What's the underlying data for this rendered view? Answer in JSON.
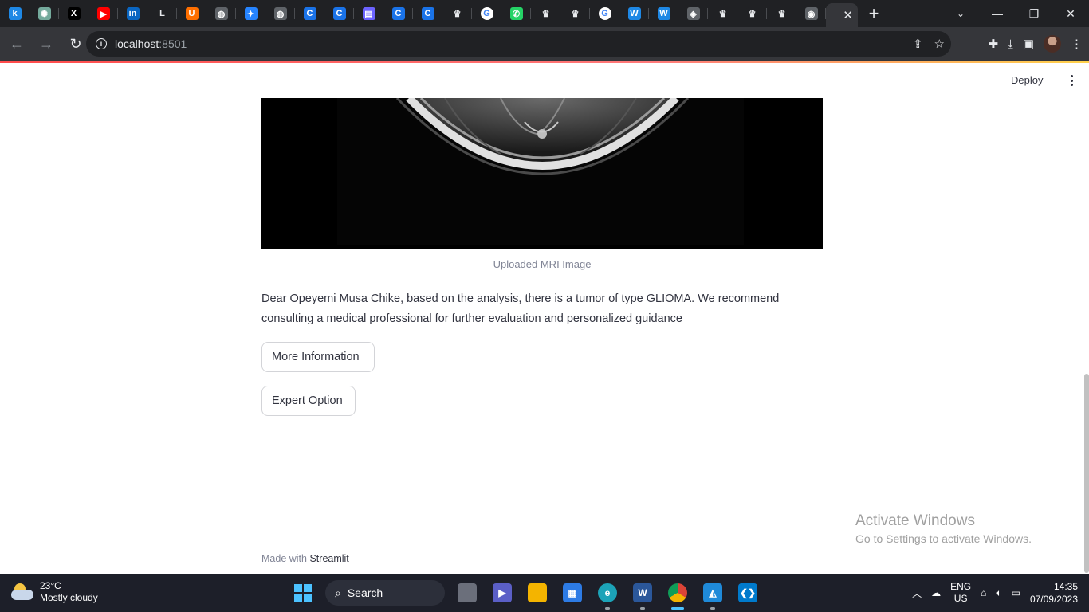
{
  "browser": {
    "tabs": [
      {
        "icon": "k",
        "color": "#1e88e5"
      },
      {
        "icon": "chatgpt",
        "color": "#74aa9c"
      },
      {
        "icon": "X",
        "color": "#000000"
      },
      {
        "icon": "youtube",
        "color": "#ff0000"
      },
      {
        "icon": "in",
        "color": "#0a66c2"
      },
      {
        "icon": "L",
        "color": "#202124"
      },
      {
        "icon": "upwork",
        "color": "#ff6f00"
      },
      {
        "icon": "globe",
        "color": "#5f6368"
      },
      {
        "icon": "jira",
        "color": "#2684ff"
      },
      {
        "icon": "globe",
        "color": "#5f6368"
      },
      {
        "icon": "C",
        "color": "#1a73e8"
      },
      {
        "icon": "C",
        "color": "#1a73e8"
      },
      {
        "icon": "doc",
        "color": "#6c63ff"
      },
      {
        "icon": "C",
        "color": "#1a73e8"
      },
      {
        "icon": "C",
        "color": "#1a73e8"
      },
      {
        "icon": "crown",
        "color": "#202124"
      },
      {
        "icon": "G",
        "color": "#ffffff"
      },
      {
        "icon": "whatsapp",
        "color": "#25d366"
      },
      {
        "icon": "crown",
        "color": "#202124"
      },
      {
        "icon": "crown",
        "color": "#202124"
      },
      {
        "icon": "G",
        "color": "#ffffff"
      },
      {
        "icon": "W",
        "color": "#1e88e5"
      },
      {
        "icon": "W",
        "color": "#1e88e5"
      },
      {
        "icon": "layers",
        "color": "#5f6368"
      },
      {
        "icon": "crown",
        "color": "#202124"
      },
      {
        "icon": "crown",
        "color": "#202124"
      },
      {
        "icon": "crown",
        "color": "#202124"
      },
      {
        "icon": "chrome",
        "color": "#5f6368"
      }
    ],
    "url_host": "localhost",
    "url_port": ":8501"
  },
  "app": {
    "deploy_label": "Deploy",
    "image_caption": "Uploaded MRI Image",
    "result_message": "Dear Opeyemi Musa Chike, based on the analysis, there is a tumor of type GLIOMA. We recommend consulting a medical professional for further evaluation and personalized guidance",
    "more_info_label": "More Information",
    "expert_option_label": "Expert Option",
    "footer_prefix": "Made with",
    "footer_brand": "Streamlit"
  },
  "watermark": {
    "title": "Activate Windows",
    "subtitle": "Go to Settings to activate Windows."
  },
  "taskbar": {
    "temperature": "23°C",
    "weather": "Mostly cloudy",
    "search_label": "Search",
    "lang_top": "ENG",
    "lang_bottom": "US",
    "time": "14:35",
    "date": "07/09/2023"
  }
}
